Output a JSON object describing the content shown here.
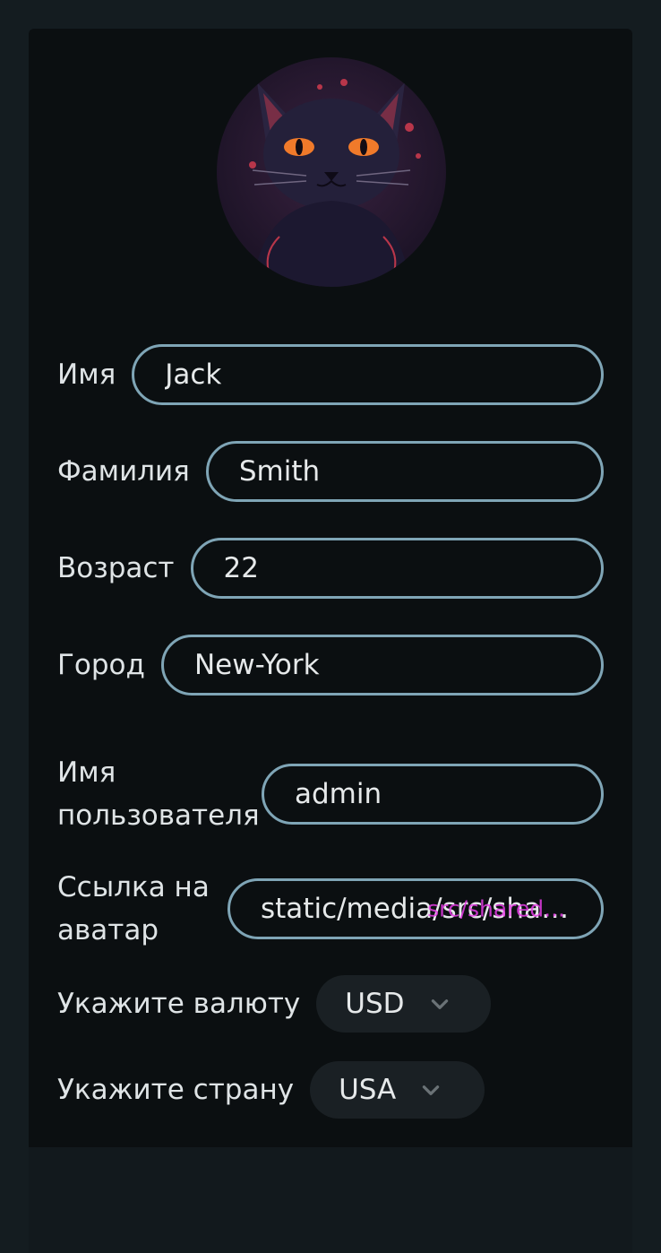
{
  "profile": {
    "fields": [
      {
        "label": "Имя",
        "value": "Jack"
      },
      {
        "label": "Фамилия",
        "value": "Smith"
      },
      {
        "label": "Возраст",
        "value": "22"
      },
      {
        "label": "Город",
        "value": "New-York"
      },
      {
        "label": "Имя пользователя",
        "value": "admin"
      },
      {
        "label": "Ссылка на аватар",
        "value": "static/media/src/share...",
        "overlay": "src/shared..."
      }
    ],
    "currency": {
      "label": "Укажите валюту",
      "value": "USD"
    },
    "country": {
      "label": "Укажите страну",
      "value": "USA"
    }
  },
  "colors": {
    "page_bg": "#141c20",
    "card_bg": "#0b0f11",
    "field_border": "#7fa5b6",
    "select_bg": "#1a2024",
    "overlay_text": "#e63ce6"
  },
  "icons": {
    "avatar": "black-cat-illustration",
    "select": "chevron-down-icon"
  }
}
